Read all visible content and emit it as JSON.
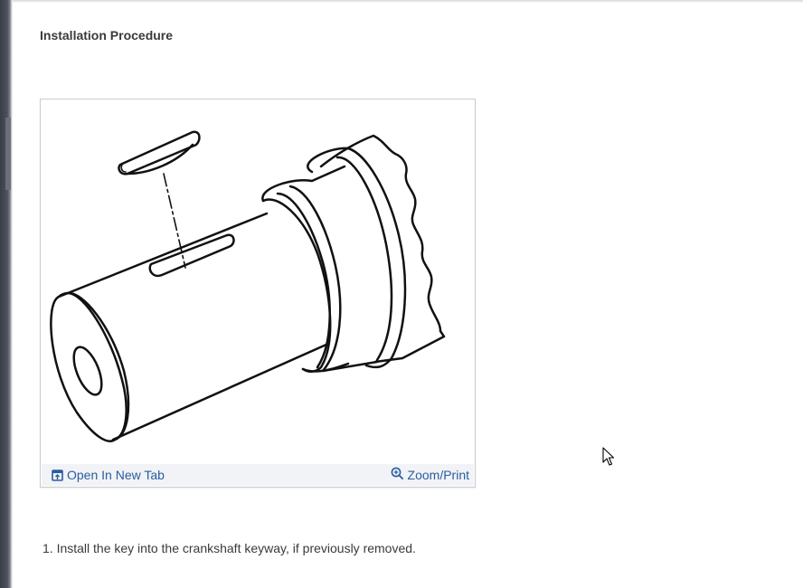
{
  "page": {
    "section_title": "Installation Procedure"
  },
  "figure": {
    "open_in_new_tab_label": "Open In New Tab",
    "open_icon": "open-in-new-tab-icon",
    "zoom_print_label": "Zoom/Print",
    "zoom_icon": "zoom-in-icon"
  },
  "steps": [
    "1. Install the key into the crankshaft keyway, if previously removed."
  ],
  "colors": {
    "link": "#2a5d9f",
    "text": "#3a3a3a",
    "figure_bar": "#f1f3f6"
  }
}
